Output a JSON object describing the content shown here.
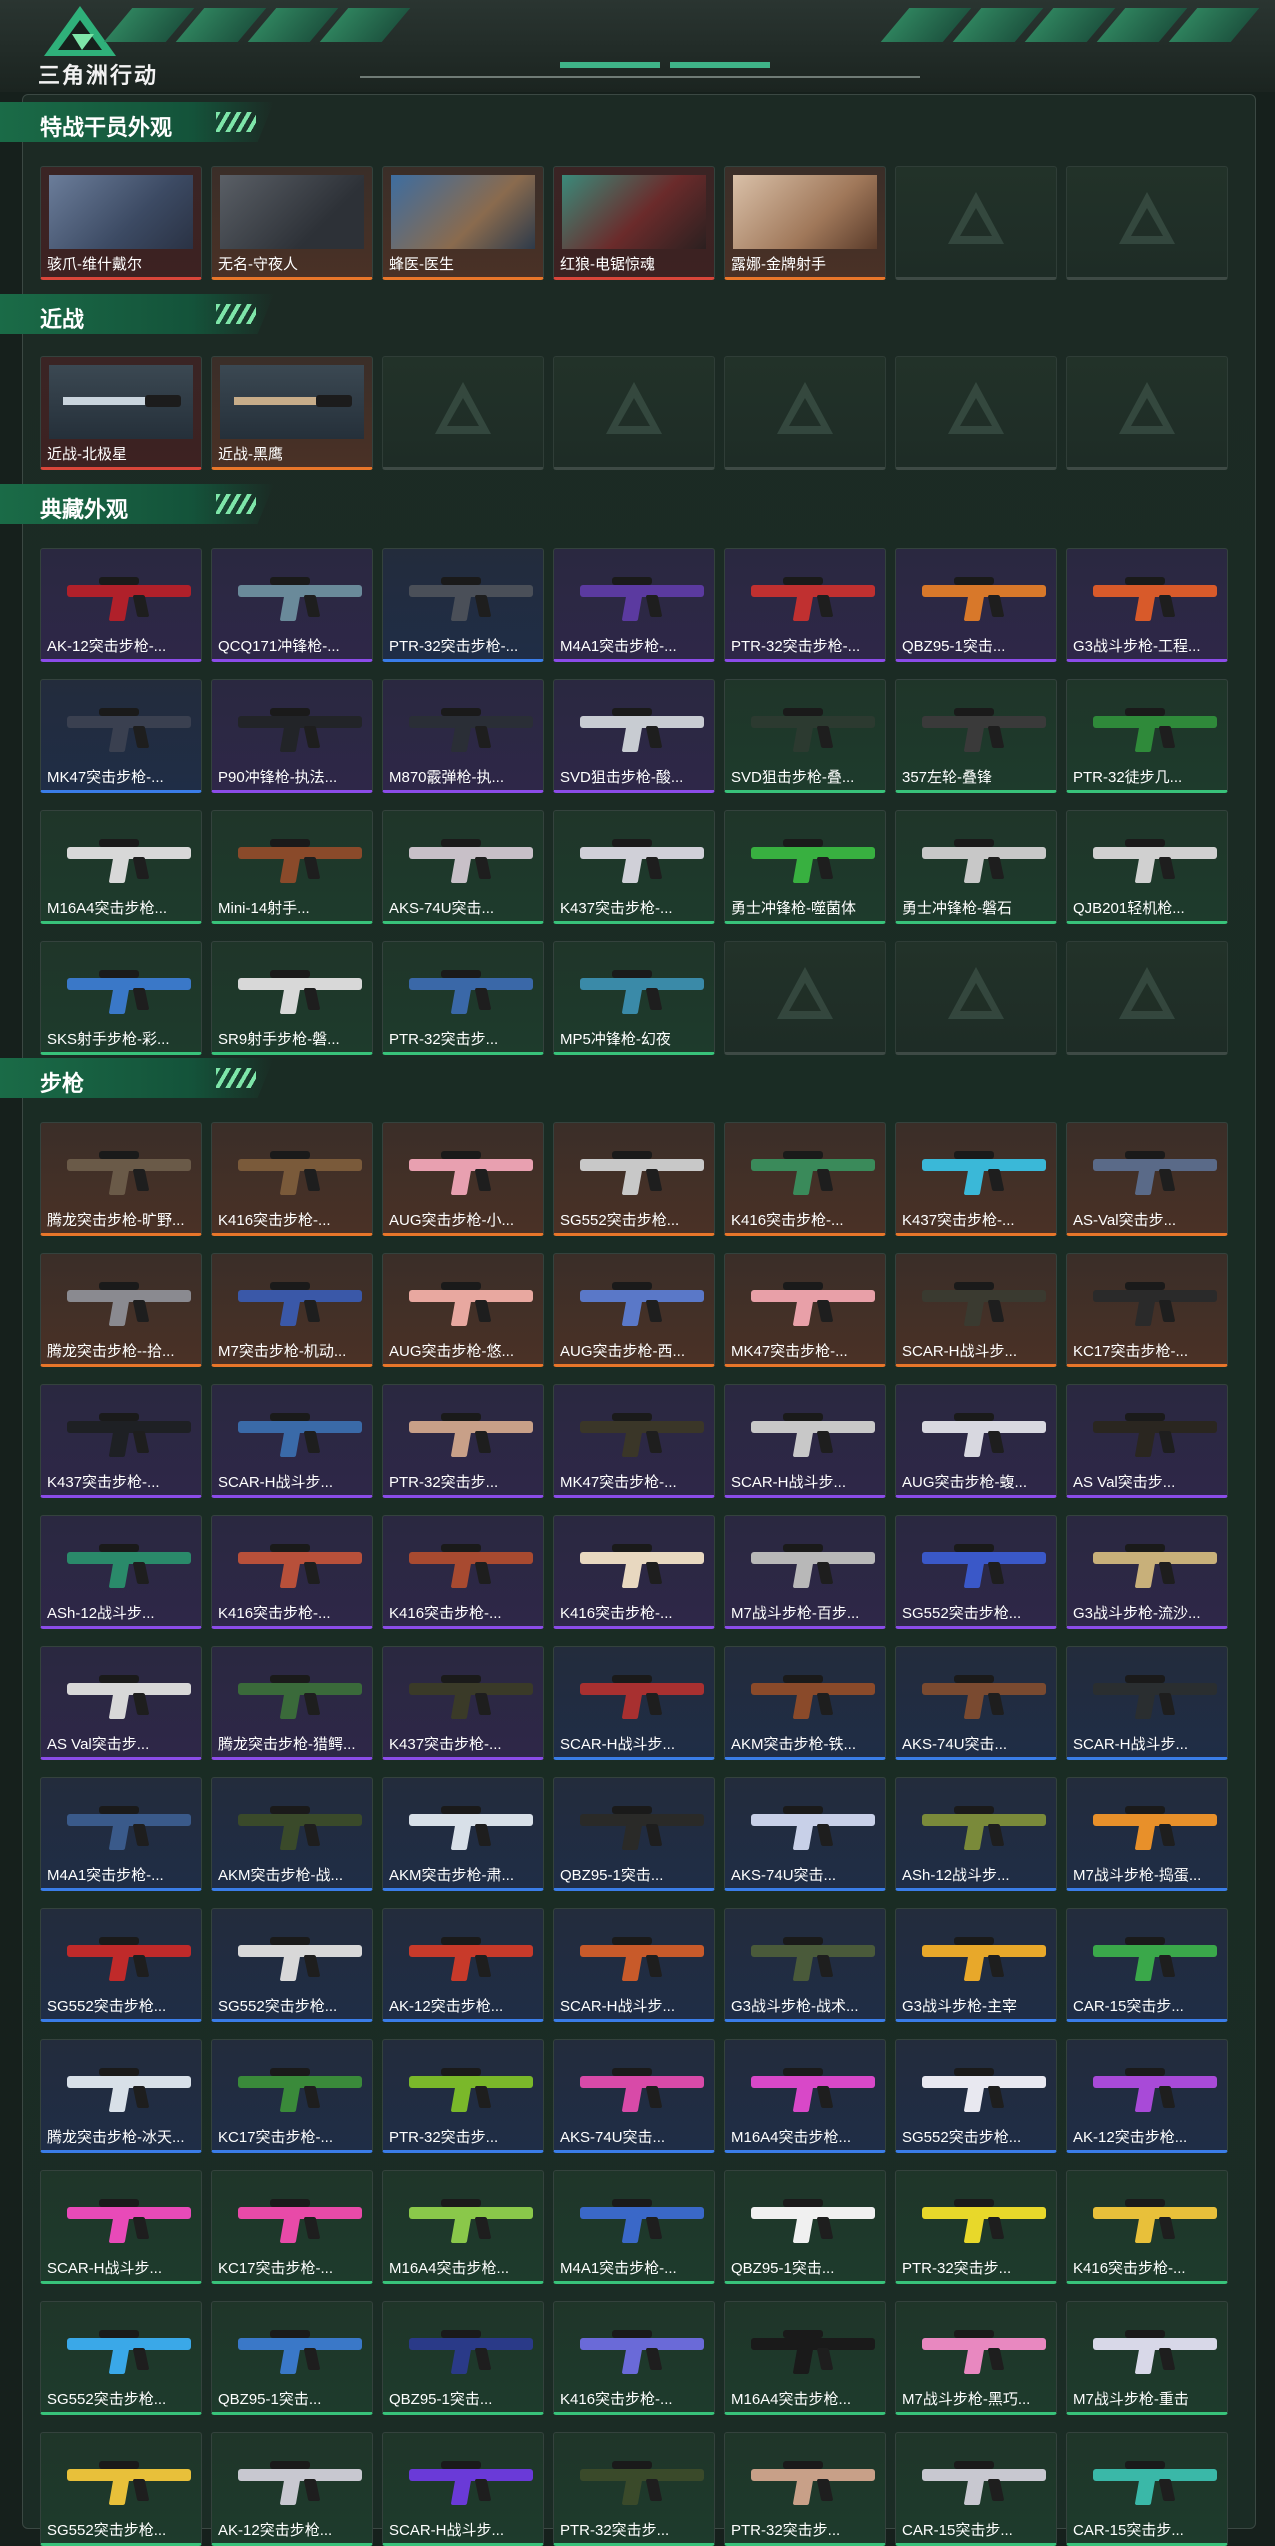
{
  "app": {
    "title": "三角洲行动"
  },
  "sections": [
    {
      "id": "operators",
      "title": "特战干员外观",
      "cards": [
        {
          "label": "骇爪-维什戴尔",
          "kind": "portrait",
          "variant": "p1",
          "rarity": "red"
        },
        {
          "label": "无名-守夜人",
          "kind": "portrait",
          "variant": "p2",
          "rarity": "orange"
        },
        {
          "label": "蜂医-医生",
          "kind": "portrait",
          "variant": "p3",
          "rarity": "orange"
        },
        {
          "label": "红狼-电锯惊魂",
          "kind": "portrait",
          "variant": "p4",
          "rarity": "red"
        },
        {
          "label": "露娜-金牌射手",
          "kind": "portrait",
          "variant": "p5",
          "rarity": "orange"
        },
        {
          "label": "",
          "kind": "empty",
          "rarity": "empty"
        },
        {
          "label": "",
          "kind": "empty",
          "rarity": "empty"
        }
      ]
    },
    {
      "id": "melee",
      "title": "近战",
      "cards": [
        {
          "label": "近战-北极星",
          "kind": "knife",
          "rarity": "red",
          "gunColor": "#c9d4dd"
        },
        {
          "label": "近战-黑鹰",
          "kind": "knife",
          "rarity": "orange",
          "gunColor": "#c7ad8a"
        },
        {
          "label": "",
          "kind": "empty",
          "rarity": "empty"
        },
        {
          "label": "",
          "kind": "empty",
          "rarity": "empty"
        },
        {
          "label": "",
          "kind": "empty",
          "rarity": "empty"
        },
        {
          "label": "",
          "kind": "empty",
          "rarity": "empty"
        },
        {
          "label": "",
          "kind": "empty",
          "rarity": "empty"
        }
      ]
    },
    {
      "id": "collection",
      "title": "典藏外观",
      "cards": [
        {
          "label": "AK-12突击步枪-...",
          "kind": "gun",
          "rarity": "purple",
          "gunColor": "#b0202a"
        },
        {
          "label": "QCQ171冲锋枪-...",
          "kind": "gun",
          "rarity": "purple",
          "gunColor": "#6a8a9a"
        },
        {
          "label": "PTR-32突击步枪-...",
          "kind": "gun",
          "rarity": "blue",
          "gunColor": "#4a4f58"
        },
        {
          "label": "M4A1突击步枪-...",
          "kind": "gun",
          "rarity": "purple",
          "gunColor": "#5b3aa0"
        },
        {
          "label": "PTR-32突击步枪-...",
          "kind": "gun",
          "rarity": "purple",
          "gunColor": "#c03030"
        },
        {
          "label": "QBZ95-1突击...",
          "kind": "gun",
          "rarity": "purple",
          "gunColor": "#d8782a"
        },
        {
          "label": "G3战斗步枪-工程...",
          "kind": "gun",
          "rarity": "purple",
          "gunColor": "#d85a2a"
        },
        {
          "label": "MK47突击步枪-...",
          "kind": "gun",
          "rarity": "blue",
          "gunColor": "#3a4050"
        },
        {
          "label": "P90冲锋枪-执法...",
          "kind": "gun",
          "rarity": "purple",
          "gunColor": "#222428"
        },
        {
          "label": "M870霰弹枪-执...",
          "kind": "gun",
          "rarity": "purple",
          "gunColor": "#2a2e36"
        },
        {
          "label": "SVD狙击步枪-酸...",
          "kind": "gun",
          "rarity": "purple",
          "gunColor": "#c8ccd2"
        },
        {
          "label": "SVD狙击步枪-叠...",
          "kind": "gun",
          "rarity": "green",
          "gunColor": "#2c3a30"
        },
        {
          "label": "357左轮-叠锋",
          "kind": "gun",
          "rarity": "green",
          "gunColor": "#3a3a3a"
        },
        {
          "label": "PTR-32徒步几...",
          "kind": "gun",
          "rarity": "green",
          "gunColor": "#2f8a3a"
        },
        {
          "label": "M16A4突击步枪...",
          "kind": "gun",
          "rarity": "green",
          "gunColor": "#d8d8d8"
        },
        {
          "label": "Mini-14射手...",
          "kind": "gun",
          "rarity": "green",
          "gunColor": "#8a4a2a"
        },
        {
          "label": "AKS-74U突击...",
          "kind": "gun",
          "rarity": "green",
          "gunColor": "#c8c0c8"
        },
        {
          "label": "K437突击步枪-...",
          "kind": "gun",
          "rarity": "green",
          "gunColor": "#d0d0d8"
        },
        {
          "label": "勇士冲锋枪-噬菌体",
          "kind": "gun",
          "rarity": "green",
          "gunColor": "#38b040"
        },
        {
          "label": "勇士冲锋枪-磐石",
          "kind": "gun",
          "rarity": "green",
          "gunColor": "#c8c8c8"
        },
        {
          "label": "QJB201轻机枪...",
          "kind": "gun",
          "rarity": "green",
          "gunColor": "#d0d0d0"
        },
        {
          "label": "SKS射手步枪-彩...",
          "kind": "gun",
          "rarity": "green",
          "gunColor": "#3a78c8"
        },
        {
          "label": "SR9射手步枪-磐...",
          "kind": "gun",
          "rarity": "green",
          "gunColor": "#d8d8d8"
        },
        {
          "label": "PTR-32突击步...",
          "kind": "gun",
          "rarity": "green",
          "gunColor": "#3a68a8"
        },
        {
          "label": "MP5冲锋枪-幻夜",
          "kind": "gun",
          "rarity": "green",
          "gunColor": "#3a8aa8"
        },
        {
          "label": "",
          "kind": "empty",
          "rarity": "empty"
        },
        {
          "label": "",
          "kind": "empty",
          "rarity": "empty"
        },
        {
          "label": "",
          "kind": "empty",
          "rarity": "empty"
        }
      ]
    },
    {
      "id": "rifles",
      "title": "步枪",
      "cards": [
        {
          "label": "腾龙突击步枪-旷野...",
          "kind": "gun",
          "rarity": "orange",
          "gunColor": "#6a5a48"
        },
        {
          "label": "K416突击步枪-...",
          "kind": "gun",
          "rarity": "orange",
          "gunColor": "#7a5a3a"
        },
        {
          "label": "AUG突击步枪-小...",
          "kind": "gun",
          "rarity": "orange",
          "gunColor": "#e8a0b0"
        },
        {
          "label": "SG552突击步枪...",
          "kind": "gun",
          "rarity": "orange",
          "gunColor": "#c8c8c8"
        },
        {
          "label": "K416突击步枪-...",
          "kind": "gun",
          "rarity": "orange",
          "gunColor": "#3a8a5a"
        },
        {
          "label": "K437突击步枪-...",
          "kind": "gun",
          "rarity": "orange",
          "gunColor": "#3ab8d8"
        },
        {
          "label": "AS-Val突击步...",
          "kind": "gun",
          "rarity": "orange",
          "gunColor": "#5a6a88"
        },
        {
          "label": "腾龙突击步枪--拾...",
          "kind": "gun",
          "rarity": "orange",
          "gunColor": "#8a8a90"
        },
        {
          "label": "M7突击步枪-机动...",
          "kind": "gun",
          "rarity": "orange",
          "gunColor": "#3a58a8"
        },
        {
          "label": "AUG突击步枪-悠...",
          "kind": "gun",
          "rarity": "orange",
          "gunColor": "#e8a8a0"
        },
        {
          "label": "AUG突击步枪-西...",
          "kind": "gun",
          "rarity": "orange",
          "gunColor": "#5a78c8"
        },
        {
          "label": "MK47突击步枪-...",
          "kind": "gun",
          "rarity": "orange",
          "gunColor": "#e8a0a8"
        },
        {
          "label": "SCAR-H战斗步...",
          "kind": "gun",
          "rarity": "orange",
          "gunColor": "#3a3a30"
        },
        {
          "label": "KC17突击步枪-...",
          "kind": "gun",
          "rarity": "orange",
          "gunColor": "#2a2a2a"
        },
        {
          "label": "K437突击步枪-...",
          "kind": "gun",
          "rarity": "purple",
          "gunColor": "#1e2024"
        },
        {
          "label": "SCAR-H战斗步...",
          "kind": "gun",
          "rarity": "purple",
          "gunColor": "#3a6aa8"
        },
        {
          "label": "PTR-32突击步...",
          "kind": "gun",
          "rarity": "purple",
          "gunColor": "#c8a088"
        },
        {
          "label": "MK47突击步枪-...",
          "kind": "gun",
          "rarity": "purple",
          "gunColor": "#3a3628"
        },
        {
          "label": "SCAR-H战斗步...",
          "kind": "gun",
          "rarity": "purple",
          "gunColor": "#c8c8c8"
        },
        {
          "label": "AUG突击步枪-蝮...",
          "kind": "gun",
          "rarity": "purple",
          "gunColor": "#d8d8e0"
        },
        {
          "label": "AS Val突击步...",
          "kind": "gun",
          "rarity": "purple",
          "gunColor": "#2a2620"
        },
        {
          "label": "ASh-12战斗步...",
          "kind": "gun",
          "rarity": "purple",
          "gunColor": "#2a8a6a"
        },
        {
          "label": "K416突击步枪-...",
          "kind": "gun",
          "rarity": "purple",
          "gunColor": "#b8503a"
        },
        {
          "label": "K416突击步枪-...",
          "kind": "gun",
          "rarity": "purple",
          "gunColor": "#a84a30"
        },
        {
          "label": "K416突击步枪-...",
          "kind": "gun",
          "rarity": "purple",
          "gunColor": "#e8d8c0"
        },
        {
          "label": "M7战斗步枪-百步...",
          "kind": "gun",
          "rarity": "purple",
          "gunColor": "#b8b8b8"
        },
        {
          "label": "SG552突击步枪...",
          "kind": "gun",
          "rarity": "purple",
          "gunColor": "#3a58c8"
        },
        {
          "label": "G3战斗步枪-流沙...",
          "kind": "gun",
          "rarity": "purple",
          "gunColor": "#c8b07a"
        },
        {
          "label": "AS Val突击步...",
          "kind": "gun",
          "rarity": "purple",
          "gunColor": "#d8d8d8"
        },
        {
          "label": "腾龙突击步枪-猎鳄...",
          "kind": "gun",
          "rarity": "purple",
          "gunColor": "#3a6a3a"
        },
        {
          "label": "K437突击步枪-...",
          "kind": "gun",
          "rarity": "purple",
          "gunColor": "#3a3a28"
        },
        {
          "label": "SCAR-H战斗步...",
          "kind": "gun",
          "rarity": "blue",
          "gunColor": "#a83030"
        },
        {
          "label": "AKM突击步枪-铁...",
          "kind": "gun",
          "rarity": "blue",
          "gunColor": "#8a4a2a"
        },
        {
          "label": "AKS-74U突击...",
          "kind": "gun",
          "rarity": "blue",
          "gunColor": "#7a4a30"
        },
        {
          "label": "SCAR-H战斗步...",
          "kind": "gun",
          "rarity": "blue",
          "gunColor": "#2a2e30"
        },
        {
          "label": "M4A1突击步枪-...",
          "kind": "gun",
          "rarity": "blue",
          "gunColor": "#3a5a8a"
        },
        {
          "label": "AKM突击步枪-战...",
          "kind": "gun",
          "rarity": "blue",
          "gunColor": "#3a4a2a"
        },
        {
          "label": "AKM突击步枪-肃...",
          "kind": "gun",
          "rarity": "blue",
          "gunColor": "#d8e0e8"
        },
        {
          "label": "QBZ95-1突击...",
          "kind": "gun",
          "rarity": "blue",
          "gunColor": "#2a2a28"
        },
        {
          "label": "AKS-74U突击...",
          "kind": "gun",
          "rarity": "blue",
          "gunColor": "#c8d0e8"
        },
        {
          "label": "ASh-12战斗步...",
          "kind": "gun",
          "rarity": "blue",
          "gunColor": "#7a8a3a"
        },
        {
          "label": "M7战斗步枪-捣蛋...",
          "kind": "gun",
          "rarity": "blue",
          "gunColor": "#e8902a"
        },
        {
          "label": "SG552突击步枪...",
          "kind": "gun",
          "rarity": "blue",
          "gunColor": "#c02a2a"
        },
        {
          "label": "SG552突击步枪...",
          "kind": "gun",
          "rarity": "blue",
          "gunColor": "#d8d8d8"
        },
        {
          "label": "AK-12突击步枪...",
          "kind": "gun",
          "rarity": "blue",
          "gunColor": "#c83a2a"
        },
        {
          "label": "SCAR-H战斗步...",
          "kind": "gun",
          "rarity": "blue",
          "gunColor": "#c85a2a"
        },
        {
          "label": "G3战斗步枪-战术...",
          "kind": "gun",
          "rarity": "blue",
          "gunColor": "#4a5a3a"
        },
        {
          "label": "G3战斗步枪-主宰",
          "kind": "gun",
          "rarity": "blue",
          "gunColor": "#e8a82a"
        },
        {
          "label": "CAR-15突击步...",
          "kind": "gun",
          "rarity": "blue",
          "gunColor": "#3aa84a"
        },
        {
          "label": "腾龙突击步枪-冰天...",
          "kind": "gun",
          "rarity": "blue",
          "gunColor": "#d8e0e8"
        },
        {
          "label": "KC17突击步枪-...",
          "kind": "gun",
          "rarity": "blue",
          "gunColor": "#3a8a3a"
        },
        {
          "label": "PTR-32突击步...",
          "kind": "gun",
          "rarity": "blue",
          "gunColor": "#7ab82a"
        },
        {
          "label": "AKS-74U突击...",
          "kind": "gun",
          "rarity": "blue",
          "gunColor": "#d84aa8"
        },
        {
          "label": "M16A4突击步枪...",
          "kind": "gun",
          "rarity": "blue",
          "gunColor": "#d848c8"
        },
        {
          "label": "SG552突击步枪...",
          "kind": "gun",
          "rarity": "blue",
          "gunColor": "#e8e8f0"
        },
        {
          "label": "AK-12突击步枪...",
          "kind": "gun",
          "rarity": "blue",
          "gunColor": "#a84ad8"
        },
        {
          "label": "SCAR-H战斗步...",
          "kind": "gun",
          "rarity": "green",
          "gunColor": "#e84ab8"
        },
        {
          "label": "KC17突击步枪-...",
          "kind": "gun",
          "rarity": "green",
          "gunColor": "#e84aa8"
        },
        {
          "label": "M16A4突击步枪...",
          "kind": "gun",
          "rarity": "green",
          "gunColor": "#8ac84a"
        },
        {
          "label": "M4A1突击步枪-...",
          "kind": "gun",
          "rarity": "green",
          "gunColor": "#3a68c8"
        },
        {
          "label": "QBZ95-1突击...",
          "kind": "gun",
          "rarity": "green",
          "gunColor": "#f0f0f0"
        },
        {
          "label": "PTR-32突击步...",
          "kind": "gun",
          "rarity": "green",
          "gunColor": "#e8d82a"
        },
        {
          "label": "K416突击步枪-...",
          "kind": "gun",
          "rarity": "green",
          "gunColor": "#e8c03a"
        },
        {
          "label": "SG552突击步枪...",
          "kind": "gun",
          "rarity": "green",
          "gunColor": "#3aa8e8"
        },
        {
          "label": "QBZ95-1突击...",
          "kind": "gun",
          "rarity": "green",
          "gunColor": "#3a78c8"
        },
        {
          "label": "QBZ95-1突击...",
          "kind": "gun",
          "rarity": "green",
          "gunColor": "#2a3a88"
        },
        {
          "label": "K416突击步枪-...",
          "kind": "gun",
          "rarity": "green",
          "gunColor": "#6a6ad8"
        },
        {
          "label": "M16A4突击步枪...",
          "kind": "gun",
          "rarity": "green",
          "gunColor": "#1a1a1a"
        },
        {
          "label": "M7战斗步枪-黑巧...",
          "kind": "gun",
          "rarity": "green",
          "gunColor": "#e888c0"
        },
        {
          "label": "M7战斗步枪-重击",
          "kind": "gun",
          "rarity": "green",
          "gunColor": "#d8d8e8"
        },
        {
          "label": "SG552突击步枪...",
          "kind": "gun",
          "rarity": "green",
          "gunColor": "#e8c03a"
        },
        {
          "label": "AK-12突击步枪...",
          "kind": "gun",
          "rarity": "green",
          "gunColor": "#c8c8d0"
        },
        {
          "label": "SCAR-H战斗步...",
          "kind": "gun",
          "rarity": "green",
          "gunColor": "#6a3ad8"
        },
        {
          "label": "PTR-32突击步...",
          "kind": "gun",
          "rarity": "green",
          "gunColor": "#3a4a2a"
        },
        {
          "label": "PTR-32突击步...",
          "kind": "gun",
          "rarity": "green",
          "gunColor": "#c8a088"
        },
        {
          "label": "CAR-15突击步...",
          "kind": "gun",
          "rarity": "green",
          "gunColor": "#c8c8d0"
        },
        {
          "label": "CAR-15突击步...",
          "kind": "gun",
          "rarity": "green",
          "gunColor": "#3ab8a8"
        }
      ]
    }
  ]
}
